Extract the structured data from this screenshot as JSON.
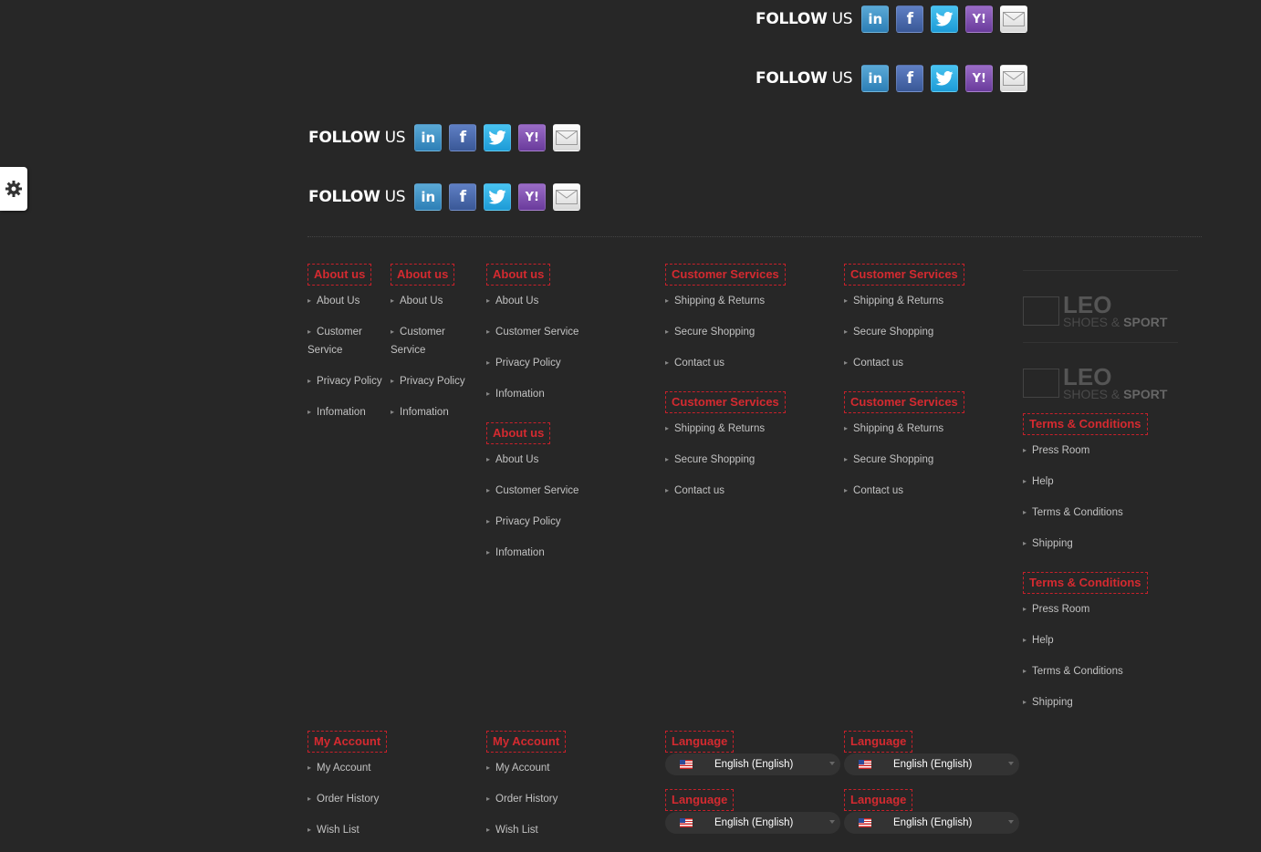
{
  "follow_label_bold": "FOLLOW",
  "follow_label_light": "US",
  "social": {
    "linkedin": "in",
    "facebook": "f",
    "yahoo": "Y!"
  },
  "about_title": "About us",
  "about_items": [
    "About Us",
    "Customer Service",
    "Privacy Policy",
    "Infomation"
  ],
  "cs_title": "Customer Services",
  "cs_items": [
    "Shipping & Returns",
    "Secure Shopping",
    "Contact us"
  ],
  "terms_title": "Terms & Conditions",
  "terms_items": [
    "Press Room",
    "Help",
    "Terms & Conditions",
    "Shipping"
  ],
  "logo": {
    "name": "LEO",
    "sub_a": "SHOES",
    "amp": "&",
    "sub_b": "SPORT"
  },
  "account_title": "My Account",
  "account_items": [
    "My Account",
    "Order History",
    "Wish List"
  ],
  "language_title": "Language",
  "language_value": "English (English)",
  "colors": {
    "accent": "#d42a30",
    "background": "#272727"
  }
}
